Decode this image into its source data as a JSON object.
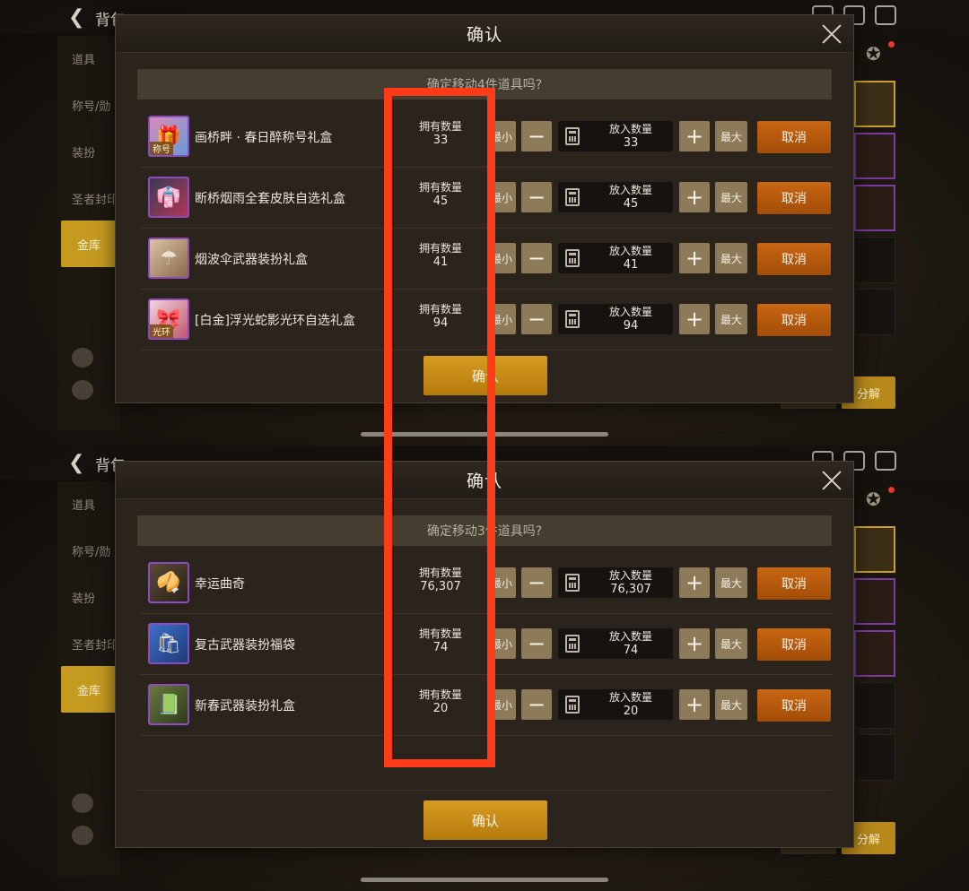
{
  "background": {
    "back_label": "背包",
    "sidebar_items": [
      "道具",
      "称号/勋",
      "装扮",
      "圣者封印"
    ],
    "vault_label": "金库",
    "decompose_label": "分解"
  },
  "dialogs": [
    {
      "title": "确认",
      "prompt": "确定移动4件道具吗?",
      "confirm_label": "确认",
      "items": [
        {
          "name": "画桥畔 · 春日醉称号礼盒",
          "owned_label": "拥有数量",
          "owned": "33",
          "min_label": "最小",
          "put_label": "放入数量",
          "put": "33",
          "max_label": "最大",
          "cancel_label": "取消",
          "icon": "title-gift-icon",
          "icon_tag": "称号"
        },
        {
          "name": "断桥烟雨全套皮肤自选礼盒",
          "owned_label": "拥有数量",
          "owned": "45",
          "min_label": "最小",
          "put_label": "放入数量",
          "put": "45",
          "max_label": "最大",
          "cancel_label": "取消",
          "icon": "skin-box-icon",
          "icon_tag": ""
        },
        {
          "name": "烟波伞武器装扮礼盒",
          "owned_label": "拥有数量",
          "owned": "41",
          "min_label": "最小",
          "put_label": "放入数量",
          "put": "41",
          "max_label": "最大",
          "cancel_label": "取消",
          "icon": "weapon-gift-icon",
          "icon_tag": ""
        },
        {
          "name": "[白金]浮光蛇影光环自选礼盒",
          "owned_label": "拥有数量",
          "owned": "94",
          "min_label": "最小",
          "put_label": "放入数量",
          "put": "94",
          "max_label": "最大",
          "cancel_label": "取消",
          "icon": "aura-gift-icon",
          "icon_tag": "光环"
        }
      ]
    },
    {
      "title": "确认",
      "prompt": "确定移动3件道具吗?",
      "confirm_label": "确认",
      "items": [
        {
          "name": "幸运曲奇",
          "owned_label": "拥有数量",
          "owned": "76,307",
          "min_label": "最小",
          "put_label": "放入数量",
          "put": "76,307",
          "max_label": "最大",
          "cancel_label": "取消",
          "icon": "fortune-cookie-icon",
          "icon_tag": ""
        },
        {
          "name": "复古武器装扮福袋",
          "owned_label": "拥有数量",
          "owned": "74",
          "min_label": "最小",
          "put_label": "放入数量",
          "put": "74",
          "max_label": "最大",
          "cancel_label": "取消",
          "icon": "lucky-bag-icon",
          "icon_tag": ""
        },
        {
          "name": "新春武器装扮礼盒",
          "owned_label": "拥有数量",
          "owned": "20",
          "min_label": "最小",
          "put_label": "放入数量",
          "put": "20",
          "max_label": "最大",
          "cancel_label": "取消",
          "icon": "spring-gift-icon",
          "icon_tag": ""
        }
      ]
    }
  ],
  "colors": {
    "highlight": "#ff3b1a",
    "cancel": "#b8580c",
    "confirm": "#c98b16"
  }
}
